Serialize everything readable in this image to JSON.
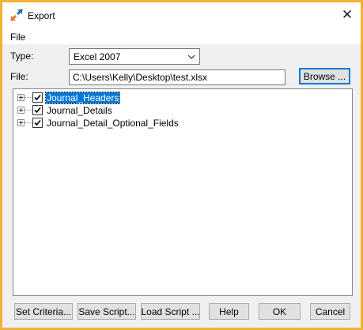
{
  "window": {
    "title": "Export",
    "icon": "export-arrows-icon",
    "close_label": "✕",
    "border_color": "#f2b234"
  },
  "menu": {
    "items": [
      {
        "label": "File"
      }
    ]
  },
  "form": {
    "type_label": "Type:",
    "type_value": "Excel 2007",
    "file_label": "File:",
    "file_value": "C:\\Users\\Kelly\\Desktop\\test.xlsx",
    "browse_label": "Browse ..."
  },
  "tree": {
    "nodes": [
      {
        "label": "Journal_Headers",
        "checked": true,
        "selected": true
      },
      {
        "label": "Journal_Details",
        "checked": true,
        "selected": false
      },
      {
        "label": "Journal_Detail_Optional_Fields",
        "checked": true,
        "selected": false
      }
    ]
  },
  "buttons": {
    "set_criteria": "Set Criteria...",
    "save_script": "Save Script...",
    "load_script": "Load Script ...",
    "help": "Help",
    "ok": "OK",
    "cancel": "Cancel"
  },
  "colors": {
    "accent": "#0078d7",
    "selection": "#0078d7",
    "icon_orange": "#e8772e",
    "icon_blue": "#1e73be"
  }
}
